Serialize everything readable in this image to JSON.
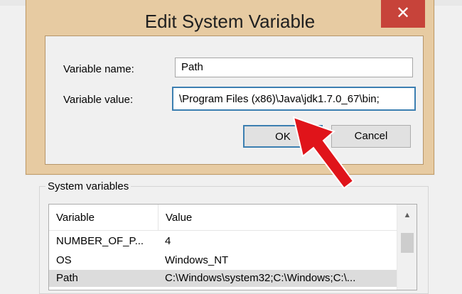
{
  "dialog": {
    "title": "Edit System Variable",
    "close_glyph": "✕",
    "name_label": "Variable name:",
    "name_value": "Path",
    "value_label": "Variable value:",
    "value_value": "\\Program Files (x86)\\Java\\jdk1.7.0_67\\bin;",
    "ok_label": "OK",
    "cancel_label": "Cancel"
  },
  "system_variables": {
    "group_title": "System variables",
    "columns": [
      "Variable",
      "Value"
    ],
    "rows": [
      {
        "variable": "NUMBER_OF_P...",
        "value": "4"
      },
      {
        "variable": "OS",
        "value": "Windows_NT"
      },
      {
        "variable": "Path",
        "value": "C:\\Windows\\system32;C:\\Windows;C:\\..."
      }
    ],
    "scroll_up_glyph": "▲"
  },
  "colors": {
    "dialog_frame": "#e7cba2",
    "close_button": "#c7433a",
    "focus_border": "#3c7fb1",
    "arrow": "#e0141a"
  },
  "icons": {
    "close": "close-icon",
    "scroll_up": "chevron-up-icon",
    "annotation": "red-arrow-annotation"
  }
}
